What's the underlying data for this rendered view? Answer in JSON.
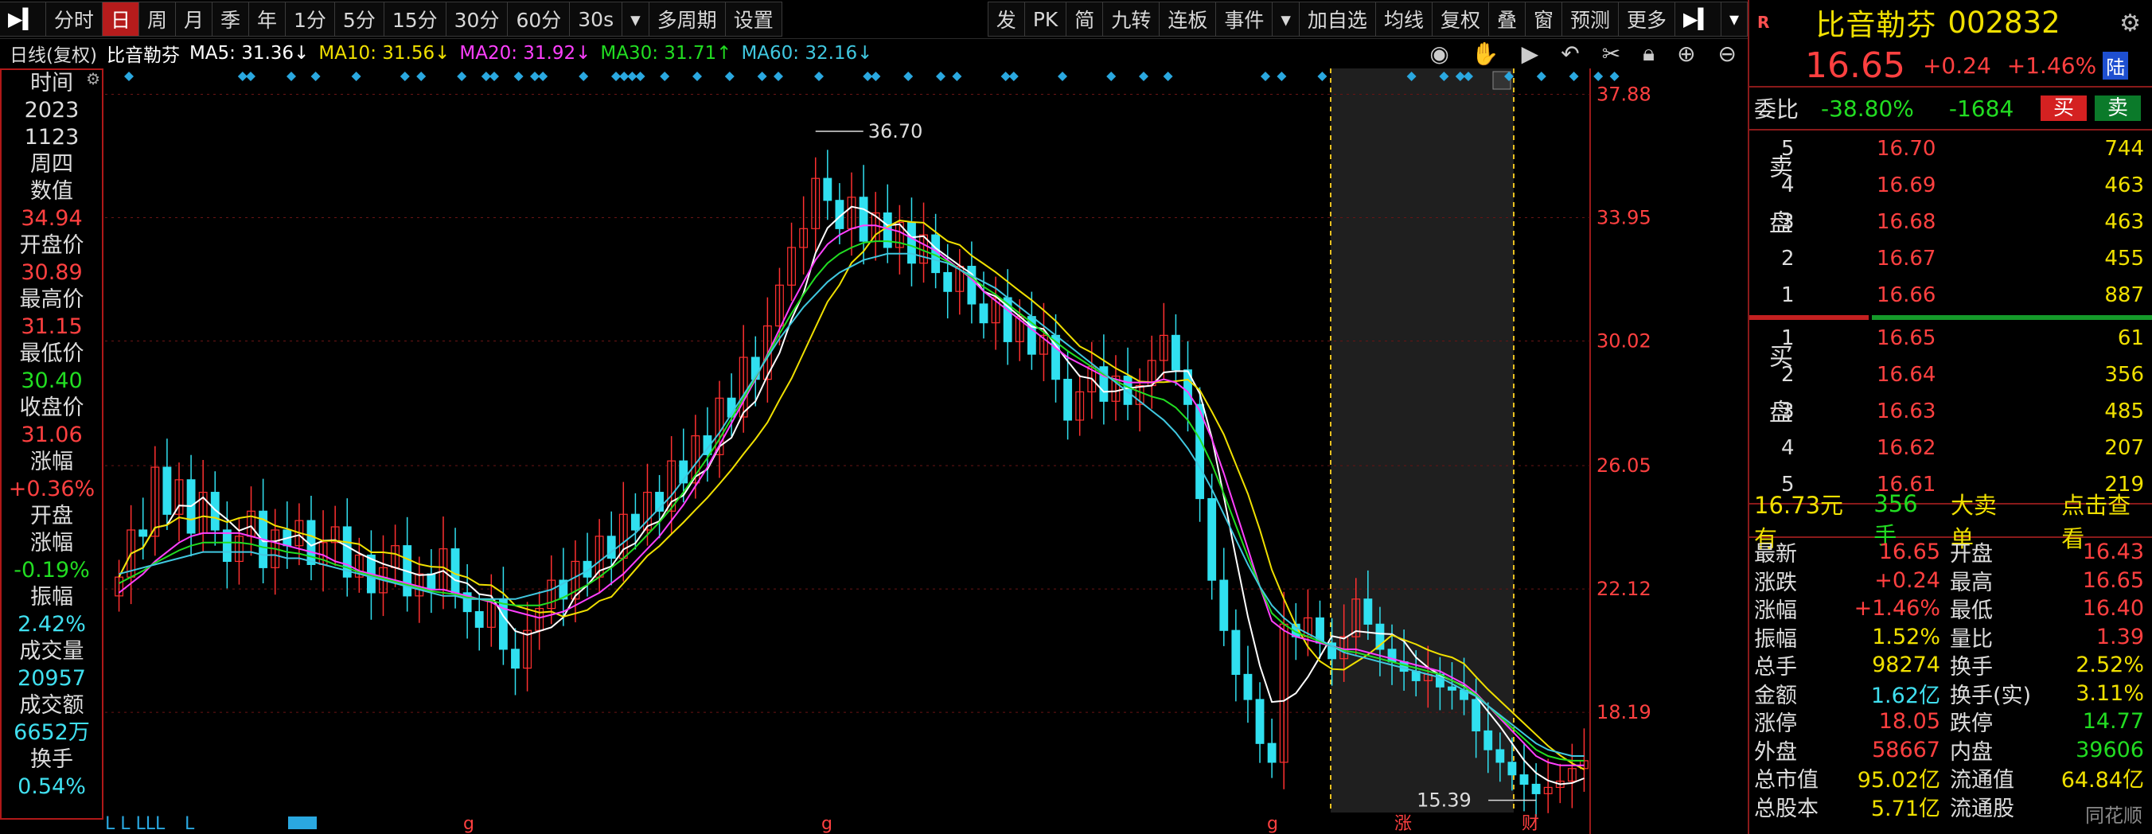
{
  "toolbar": {
    "left": [
      "分时",
      "日",
      "周",
      "月",
      "季",
      "年",
      "1分",
      "5分",
      "15分",
      "30分",
      "60分",
      "30s",
      "多周期",
      "设置"
    ],
    "active": "日",
    "right": [
      "发",
      "PK",
      "简",
      "九转",
      "连板",
      "事件",
      "加自选",
      "均线",
      "复权",
      "叠",
      "窗",
      "预测",
      "更多"
    ]
  },
  "infobar": {
    "period": "日线(复权)",
    "name": "比音勒芬",
    "ma5": "MA5: 31.36↓",
    "ma10": "MA10: 31.56↓",
    "ma20": "MA20: 31.92↓",
    "ma30": "MA30: 31.71↑",
    "ma60": "MA60: 32.16↓",
    "colors": {
      "ma5": "#ffffff",
      "ma10": "#f0e000",
      "ma20": "#ff40ff",
      "ma30": "#22dd22",
      "ma60": "#40c8e0"
    }
  },
  "datapanel": [
    {
      "t": "时间",
      "c": "lbl"
    },
    {
      "t": "2023",
      "c": "lbl"
    },
    {
      "t": "1123",
      "c": "lbl"
    },
    {
      "t": "周四",
      "c": "lbl"
    },
    {
      "t": "数值",
      "c": "lbl"
    },
    {
      "t": "34.94",
      "c": "red"
    },
    {
      "t": "开盘价",
      "c": "lbl"
    },
    {
      "t": "30.89",
      "c": "red"
    },
    {
      "t": "最高价",
      "c": "lbl"
    },
    {
      "t": "31.15",
      "c": "red"
    },
    {
      "t": "最低价",
      "c": "lbl"
    },
    {
      "t": "30.40",
      "c": "green"
    },
    {
      "t": "收盘价",
      "c": "lbl"
    },
    {
      "t": "31.06",
      "c": "red"
    },
    {
      "t": "涨幅",
      "c": "lbl"
    },
    {
      "t": "+0.36%",
      "c": "red"
    },
    {
      "t": "开盘",
      "c": "lbl"
    },
    {
      "t": "涨幅",
      "c": "lbl"
    },
    {
      "t": "-0.19%",
      "c": "green"
    },
    {
      "t": "振幅",
      "c": "lbl"
    },
    {
      "t": "2.42%",
      "c": "cyan"
    },
    {
      "t": "成交量",
      "c": "lbl"
    },
    {
      "t": "20957",
      "c": "cyan"
    },
    {
      "t": "成交额",
      "c": "lbl"
    },
    {
      "t": "6652万",
      "c": "cyan"
    },
    {
      "t": "换手",
      "c": "lbl"
    },
    {
      "t": "0.54%",
      "c": "cyan"
    }
  ],
  "chart_data": {
    "type": "candlestick",
    "title": "比音勒芬 日线(复权)",
    "y_ticks": [
      "37.88",
      "33.95",
      "30.02",
      "26.05",
      "22.12",
      "18.19"
    ],
    "ylim": [
      15.0,
      38.5
    ],
    "max_label": "36.70",
    "min_label": "15.39",
    "shaded_range_label": "",
    "bottom_marks": [
      "L L LLL",
      "L",
      "g",
      "g",
      "g",
      "涨",
      "财"
    ],
    "close": [
      22.5,
      24.0,
      23.8,
      26.0,
      24.5,
      25.6,
      23.9,
      25.2,
      24.0,
      23.0,
      23.8,
      24.6,
      22.8,
      24.0,
      23.5,
      24.3,
      22.9,
      23.6,
      24.1,
      22.5,
      23.2,
      22.0,
      22.8,
      23.5,
      21.9,
      22.6,
      22.1,
      23.4,
      22.0,
      21.4,
      20.9,
      21.8,
      20.2,
      19.6,
      20.8,
      21.5,
      22.4,
      21.8,
      23.0,
      22.5,
      23.8,
      23.1,
      24.5,
      24.0,
      25.2,
      24.6,
      26.2,
      25.5,
      27.0,
      26.4,
      28.2,
      27.6,
      29.5,
      28.8,
      30.5,
      31.8,
      33.0,
      33.6,
      35.2,
      34.5,
      33.6,
      34.6,
      33.2,
      34.1,
      33.0,
      33.8,
      32.5,
      33.4,
      32.2,
      31.6,
      32.4,
      31.2,
      30.6,
      31.4,
      30.0,
      30.8,
      29.6,
      30.2,
      28.8,
      27.5,
      28.4,
      29.2,
      28.1,
      28.9,
      28.0,
      28.6,
      29.4,
      30.2,
      29.1,
      28.0,
      25.0,
      22.4,
      20.8,
      19.4,
      18.6,
      17.2,
      16.6,
      21.0,
      20.6,
      21.2,
      20.4,
      19.9,
      20.6,
      21.8,
      21.0,
      20.2,
      19.8,
      19.5,
      19.2,
      19.4,
      19.0,
      18.9,
      18.6,
      17.6,
      17.0,
      16.6,
      16.2,
      15.9,
      15.6,
      15.8,
      16.0,
      16.4,
      16.65
    ],
    "ma20": [
      22.0,
      22.3,
      22.6,
      23.0,
      23.3,
      23.6,
      23.8,
      23.9,
      23.9,
      23.9,
      23.9,
      23.8,
      23.7,
      23.6,
      23.5,
      23.4,
      23.3,
      23.2,
      23.0,
      22.9,
      22.7,
      22.6,
      22.5,
      22.4,
      22.3,
      22.2,
      22.1,
      22.1,
      22.0,
      21.9,
      21.8,
      21.7,
      21.5,
      21.4,
      21.3,
      21.2,
      21.3,
      21.4,
      21.6,
      21.8,
      22.0,
      22.3,
      22.6,
      23.0,
      23.4,
      23.8,
      24.3,
      24.8,
      25.4,
      26.0,
      26.7,
      27.4,
      28.1,
      28.8,
      29.6,
      30.4,
      31.2,
      31.9,
      32.6,
      33.1,
      33.4,
      33.6,
      33.7,
      33.7,
      33.6,
      33.5,
      33.3,
      33.1,
      32.9,
      32.6,
      32.3,
      32.0,
      31.6,
      31.3,
      31.0,
      30.7,
      30.4,
      30.1,
      29.8,
      29.5,
      29.3,
      29.1,
      28.9,
      28.8,
      28.7,
      28.7,
      28.7,
      28.8,
      28.7,
      28.4,
      27.8,
      26.9,
      25.8,
      24.6,
      23.4,
      22.2,
      21.1,
      20.8,
      20.6,
      20.5,
      20.4,
      20.3,
      20.2,
      20.2,
      20.1,
      20.0,
      19.9,
      19.8,
      19.7,
      19.6,
      19.5,
      19.3,
      19.1,
      18.8,
      18.4,
      18.0,
      17.6,
      17.2,
      16.8,
      16.6,
      16.5,
      16.5,
      16.5
    ],
    "ma60": [
      22.6,
      22.7,
      22.8,
      22.9,
      23.0,
      23.1,
      23.2,
      23.3,
      23.3,
      23.3,
      23.3,
      23.3,
      23.2,
      23.2,
      23.1,
      23.1,
      23.0,
      22.9,
      22.8,
      22.7,
      22.6,
      22.5,
      22.4,
      22.3,
      22.2,
      22.1,
      22.0,
      21.9,
      21.9,
      21.8,
      21.8,
      21.8,
      21.8,
      21.8,
      21.9,
      22.0,
      22.1,
      22.3,
      22.5,
      22.7,
      23.0,
      23.3,
      23.6,
      23.9,
      24.3,
      24.7,
      25.1,
      25.6,
      26.1,
      26.6,
      27.1,
      27.7,
      28.3,
      28.9,
      29.5,
      30.1,
      30.6,
      31.1,
      31.5,
      31.9,
      32.2,
      32.4,
      32.6,
      32.7,
      32.8,
      32.8,
      32.8,
      32.7,
      32.6,
      32.5,
      32.3,
      32.1,
      31.9,
      31.7,
      31.4,
      31.1,
      30.8,
      30.5,
      30.2,
      29.9,
      29.6,
      29.3,
      29.0,
      28.7,
      28.4,
      28.1,
      27.8,
      27.5,
      27.1,
      26.6,
      26.0,
      25.3,
      24.5,
      23.7,
      22.9,
      22.2,
      21.6,
      21.2,
      20.9,
      20.7,
      20.5,
      20.3,
      20.1,
      20.0,
      19.9,
      19.8,
      19.7,
      19.6,
      19.5,
      19.4,
      19.3,
      19.1,
      18.9,
      18.7,
      18.4,
      18.1,
      17.8,
      17.5,
      17.2,
      17.0,
      16.9,
      16.8,
      16.8
    ]
  },
  "rightpanel": {
    "logo": "R",
    "name": "比音勒芬",
    "code": "002832",
    "price": "16.65",
    "change": "+0.24",
    "pct": "+1.46%",
    "tag": "陆",
    "weibi_label": "委比",
    "weibi_pct": "-38.80%",
    "weibi_diff": "-1684",
    "buy_btn": "买",
    "sell_btn": "卖",
    "sell_side": "卖盘",
    "buy_side": "买盘",
    "asks": [
      {
        "lv": "5",
        "p": "16.70",
        "v": "744"
      },
      {
        "lv": "4",
        "p": "16.69",
        "v": "463"
      },
      {
        "lv": "3",
        "p": "16.68",
        "v": "463"
      },
      {
        "lv": "2",
        "p": "16.67",
        "v": "455"
      },
      {
        "lv": "1",
        "p": "16.66",
        "v": "887"
      }
    ],
    "bids": [
      {
        "lv": "1",
        "p": "16.65",
        "v": "61"
      },
      {
        "lv": "2",
        "p": "16.64",
        "v": "356"
      },
      {
        "lv": "3",
        "p": "16.63",
        "v": "485"
      },
      {
        "lv": "4",
        "p": "16.62",
        "v": "207"
      },
      {
        "lv": "5",
        "p": "16.61",
        "v": "219"
      }
    ],
    "bigorder": {
      "a": "16.73元有",
      "b": "356手",
      "c": "大卖单",
      "d": "点击查看"
    },
    "stats": [
      {
        "k1": "最新",
        "v1": "16.65",
        "c1": "c-red",
        "k2": "开盘",
        "v2": "16.43",
        "c2": "c-red"
      },
      {
        "k1": "涨跌",
        "v1": "+0.24",
        "c1": "c-red",
        "k2": "最高",
        "v2": "16.65",
        "c2": "c-red"
      },
      {
        "k1": "涨幅",
        "v1": "+1.46%",
        "c1": "c-red",
        "k2": "最低",
        "v2": "16.40",
        "c2": "c-red"
      },
      {
        "k1": "振幅",
        "v1": "1.52%",
        "c1": "c-yellow",
        "k2": "量比",
        "v2": "1.39",
        "c2": "c-red"
      },
      {
        "k1": "总手",
        "v1": "98274",
        "c1": "c-yellow",
        "k2": "换手",
        "v2": "2.52%",
        "c2": "c-yellow"
      },
      {
        "k1": "金额",
        "v1": "1.62亿",
        "c1": "c-cyan",
        "k2": "换手(实)",
        "v2": "3.11%",
        "c2": "c-yellow"
      },
      {
        "k1": "涨停",
        "v1": "18.05",
        "c1": "c-red",
        "k2": "跌停",
        "v2": "14.77",
        "c2": "c-green"
      },
      {
        "k1": "外盘",
        "v1": "58667",
        "c1": "c-red",
        "k2": "内盘",
        "v2": "39606",
        "c2": "c-green"
      },
      {
        "k1": "总市值",
        "v1": "95.02亿",
        "c1": "c-yellow",
        "k2": "流通值",
        "v2": "64.84亿",
        "c2": "c-yellow"
      },
      {
        "k1": "总股本",
        "v1": "5.71亿",
        "c1": "c-yellow",
        "k2": "流通股",
        "v2": "",
        "c2": "c-yellow"
      }
    ],
    "watermark": "同花顺"
  }
}
